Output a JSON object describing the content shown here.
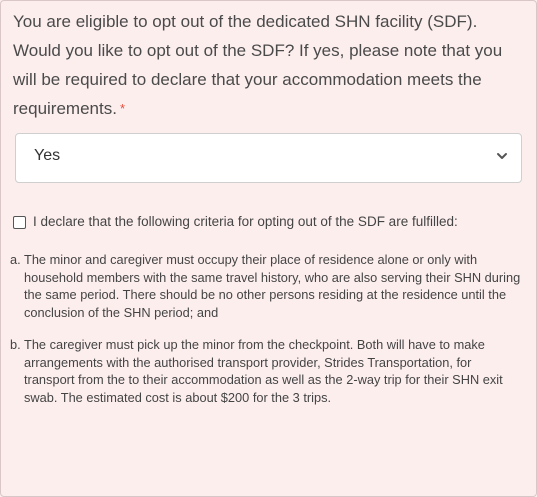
{
  "question": {
    "text": "You are eligible to opt out of the dedicated SHN facility (SDF). Would you like to opt out of the SDF? If yes, please note that you will be required to declare that your accommodation meets the requirements.",
    "required_marker": "*"
  },
  "select": {
    "value": "Yes",
    "icon": "chevron-down-icon"
  },
  "declaration": {
    "checked": false,
    "label": "I declare that the following criteria for opting out of the SDF are fulfilled:"
  },
  "criteria": [
    {
      "marker": "a.",
      "text": "The minor and caregiver must occupy their place of residence alone or only with household members with the same travel history, who are also serving their SHN during the same period. There should be no other persons residing at the residence until the conclusion of the SHN period; and"
    },
    {
      "marker": "b.",
      "text": "The caregiver must pick up the minor from the checkpoint. Both will have to make arrangements with the authorised transport provider, Strides Transportation, for transport from the to their accommodation as well as the 2-way trip for their SHN exit swab. The estimated cost is about $200 for the 3 trips."
    }
  ],
  "colors": {
    "background": "#fdeeee",
    "required": "#e74c3c",
    "text": "#4a4a4a"
  }
}
